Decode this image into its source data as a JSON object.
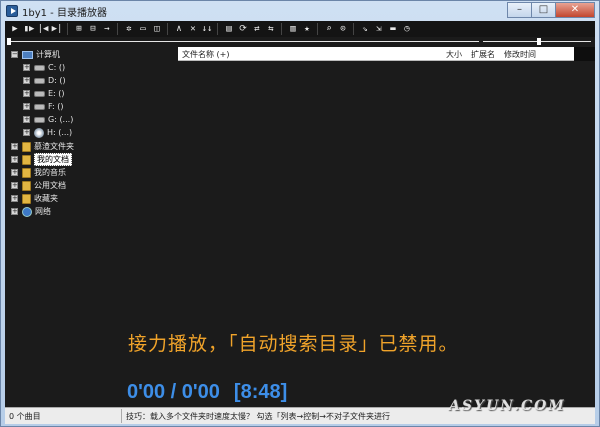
{
  "window": {
    "title": "1by1 - 目录播放器",
    "minimize": "–",
    "maximize": "□",
    "close": "✕"
  },
  "toolbar": {
    "groups": [
      [
        "▶",
        "▮▶",
        "|◀",
        "▶|"
      ],
      [
        "⊞",
        "⊟",
        "→"
      ],
      [
        "✲",
        "▭",
        "◫"
      ],
      [
        "∧",
        "✕",
        "↓↓"
      ],
      [
        "▤",
        "⟳",
        "⇄",
        "⇆"
      ],
      [
        "▥",
        "★"
      ],
      [
        "⌕",
        "⊙"
      ],
      [
        "⇘",
        "⇲",
        "▬",
        "◷"
      ]
    ]
  },
  "tree": {
    "items": [
      {
        "label": "计算机",
        "icon": "computer-icon",
        "level": 0,
        "expander": "−"
      },
      {
        "label": "C: ()",
        "icon": "drive-icon",
        "level": 1,
        "expander": "+"
      },
      {
        "label": "D: ()",
        "icon": "drive-icon",
        "level": 1,
        "expander": "+"
      },
      {
        "label": "E: ()",
        "icon": "drive-icon",
        "level": 1,
        "expander": "+"
      },
      {
        "label": "F: ()",
        "icon": "drive-icon",
        "level": 1,
        "expander": "+"
      },
      {
        "label": "G: (...)",
        "icon": "drive-icon",
        "level": 1,
        "expander": "+"
      },
      {
        "label": "H: (...)",
        "icon": "cd-drive-icon",
        "level": 1,
        "expander": "+"
      },
      {
        "label": "慕渣文件夹",
        "icon": "folder-icon",
        "level": 0,
        "expander": "+"
      },
      {
        "label": "我的文档",
        "icon": "folder-icon",
        "level": 0,
        "expander": "+",
        "selected": true
      },
      {
        "label": "我的音乐",
        "icon": "folder-icon",
        "level": 0,
        "expander": "+"
      },
      {
        "label": "公用文档",
        "icon": "folder-icon",
        "level": 0,
        "expander": "+"
      },
      {
        "label": "收藏夹",
        "icon": "folder-icon",
        "level": 0,
        "expander": "+"
      },
      {
        "label": "网络",
        "icon": "network-icon",
        "level": 0,
        "expander": "+"
      }
    ]
  },
  "file_list": {
    "columns": {
      "name": "文件名称 (+)",
      "size": "大小",
      "ext": "扩展名",
      "modified": "修改时间"
    }
  },
  "player": {
    "notice": "接力播放，「自动搜索目录」已禁用。",
    "time": "0'00 / 0'00",
    "total": "[8:48]",
    "seek_progress": 0,
    "volume_level": 0.52
  },
  "status": {
    "count": "0 个曲目",
    "tip": "技巧：载入多个文件夹时速度太慢？ 勾选「列表→控制→不对子文件夹进行"
  },
  "watermark": "ASYUN.COM",
  "colors": {
    "background": "#1b1b1b",
    "notice": "#f0a32a",
    "time": "#3d8ee8"
  }
}
